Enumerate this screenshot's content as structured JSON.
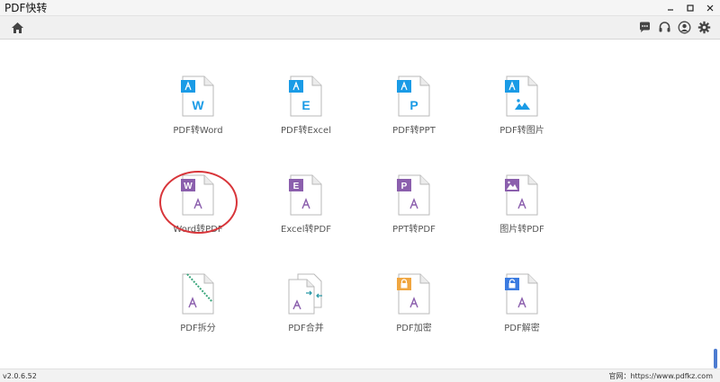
{
  "window": {
    "title": "PDF快转",
    "controls": [
      "minimize-icon",
      "maximize-icon",
      "close-icon"
    ]
  },
  "toolbar": {
    "home_icon": "home-icon",
    "right_icons": [
      "chat-icon",
      "headset-icon",
      "user-icon",
      "gear-icon"
    ]
  },
  "tools": [
    {
      "label": "PDF转Word",
      "badge": "W",
      "badge_color": "#1a9be6",
      "icon": "pdf-to-word-icon"
    },
    {
      "label": "PDF转Excel",
      "badge": "E",
      "badge_color": "#1a9be6",
      "icon": "pdf-to-excel-icon"
    },
    {
      "label": "PDF转PPT",
      "badge": "P",
      "badge_color": "#1a9be6",
      "icon": "pdf-to-ppt-icon"
    },
    {
      "label": "PDF转图片",
      "badge": "img",
      "badge_color": "#1a9be6",
      "icon": "pdf-to-image-icon"
    },
    {
      "label": "Word转PDF",
      "badge": "W",
      "badge_color": "#8b5fad",
      "icon": "word-to-pdf-icon"
    },
    {
      "label": "Excel转PDF",
      "badge": "E",
      "badge_color": "#8b5fad",
      "icon": "excel-to-pdf-icon"
    },
    {
      "label": "PPT转PDF",
      "badge": "P",
      "badge_color": "#8b5fad",
      "icon": "ppt-to-pdf-icon"
    },
    {
      "label": "图片转PDF",
      "badge": "img",
      "badge_color": "#8b5fad",
      "icon": "image-to-pdf-icon"
    },
    {
      "label": "PDF拆分",
      "badge": "split",
      "badge_color": "#3aa67c",
      "icon": "pdf-split-icon"
    },
    {
      "label": "PDF合并",
      "badge": "merge",
      "badge_color": "#2c9aa8",
      "icon": "pdf-merge-icon"
    },
    {
      "label": "PDF加密",
      "badge": "lock",
      "badge_color": "#f0a640",
      "icon": "pdf-encrypt-icon"
    },
    {
      "label": "PDF解密",
      "badge": "unlock",
      "badge_color": "#3b7be0",
      "icon": "pdf-decrypt-icon"
    }
  ],
  "status": {
    "version": "v2.0.6.52",
    "website": "官网：https://www.pdfkz.com"
  },
  "colors": {
    "pdf_to_x": "#1a9be6",
    "x_to_pdf": "#8b5fad",
    "adobe_symbol": "#8b5fad",
    "highlight": "#d8353a"
  }
}
